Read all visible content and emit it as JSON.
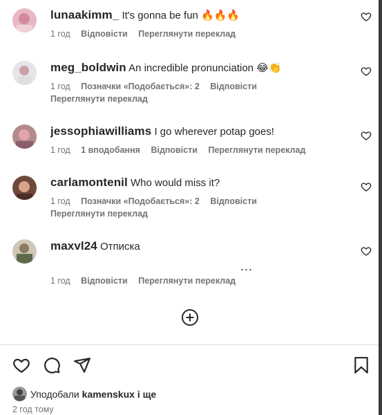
{
  "comments": [
    {
      "username": "lunaakimm_",
      "text": "It's gonna be fun 🔥🔥🔥",
      "time": "1 год",
      "likes": "",
      "reply": "Відповісти",
      "translate": "Переглянути переклад"
    },
    {
      "username": "meg_boldwin",
      "text": "An incredible pronunciation 😂👏",
      "time": "1 год",
      "likes": "Позначки «Подобається»: 2",
      "reply": "Відповісти",
      "translate": "Переглянути переклад"
    },
    {
      "username": "jessophiawilliams",
      "text": "I go wherever potap goes!",
      "time": "1 год",
      "likes": "1 вподобання",
      "reply": "Відповісти",
      "translate": "Переглянути переклад"
    },
    {
      "username": "carlamontenil",
      "text": "Who would miss it?",
      "time": "1 год",
      "likes": "Позначки «Подобається»: 2",
      "reply": "Відповісти",
      "translate": "Переглянути переклад"
    },
    {
      "username": "maxvl24",
      "text": "Отписка",
      "time": "1 год",
      "likes": "",
      "reply": "Відповісти",
      "translate": "Переглянути переклад"
    }
  ],
  "more_options": "...",
  "footer": {
    "liked_by_prefix": "Уподобали",
    "liked_by_user": "kamenskux",
    "liked_by_suffix": "і ще",
    "time_ago": "2 год тому"
  },
  "icons": [
    "heart-icon",
    "comment-icon",
    "share-icon",
    "bookmark-icon",
    "add-circle-icon",
    "more-options-icon"
  ],
  "colors": {
    "text": "#262626",
    "secondary": "#737373",
    "divider": "#dbdbdb"
  }
}
